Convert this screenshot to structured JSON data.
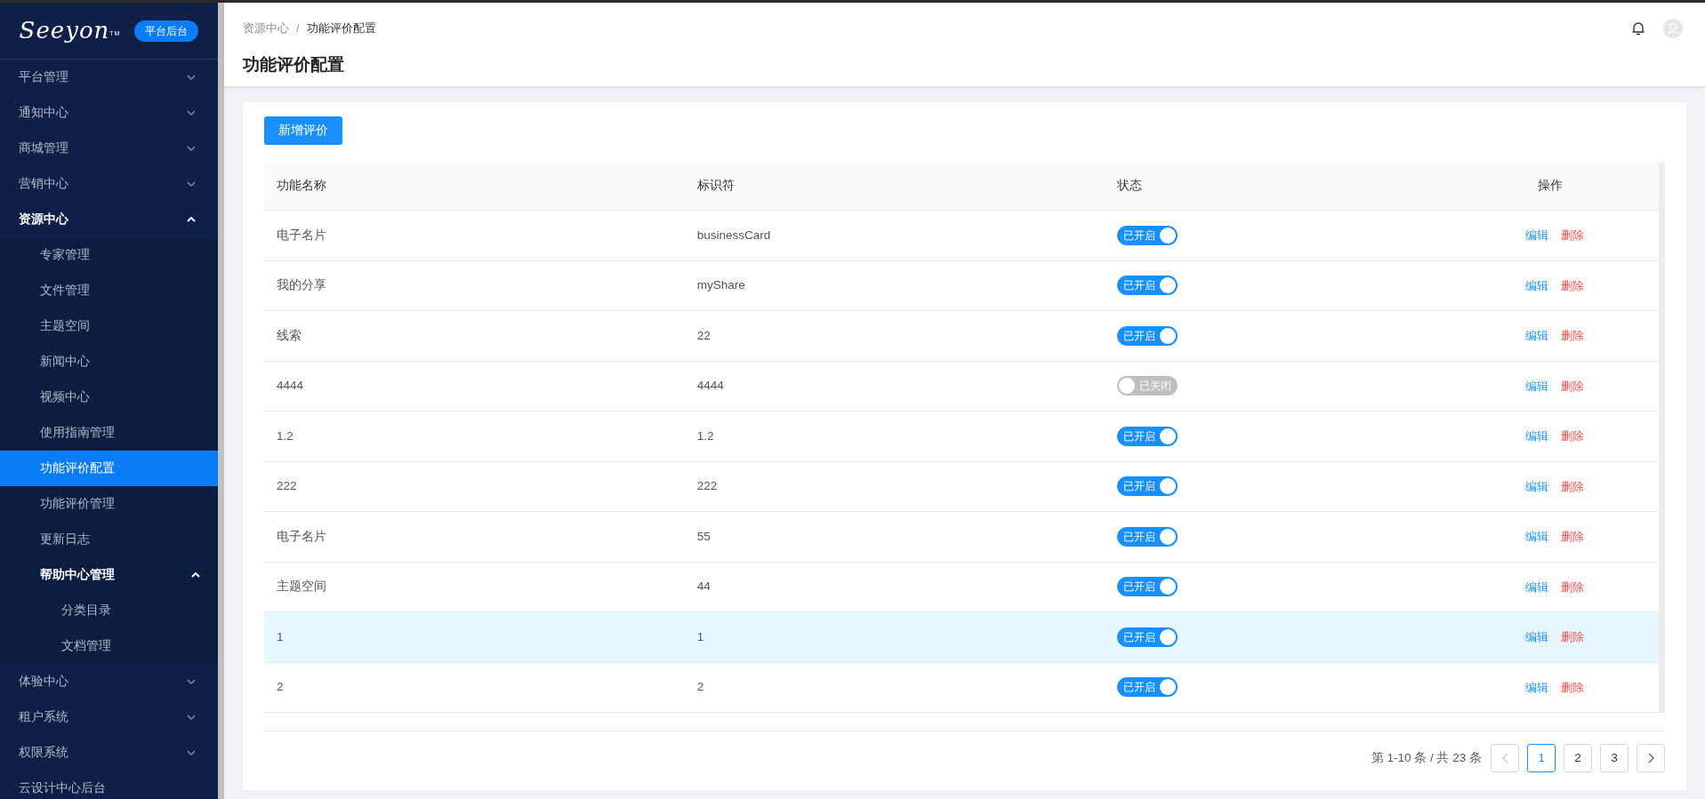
{
  "sidebar": {
    "logo": "Seeyon",
    "logo_mark": "TM",
    "badge": "平台后台",
    "items": [
      {
        "label": "平台管理",
        "expanded": false,
        "selected": false
      },
      {
        "label": "通知中心",
        "expanded": false,
        "selected": false
      },
      {
        "label": "商城管理",
        "expanded": false,
        "selected": false
      },
      {
        "label": "营销中心",
        "expanded": false,
        "selected": false
      },
      {
        "label": "资源中心",
        "expanded": true,
        "selected": false,
        "children": [
          {
            "label": "专家管理",
            "selected": false
          },
          {
            "label": "文件管理",
            "selected": false
          },
          {
            "label": "主题空间",
            "selected": false
          },
          {
            "label": "新闻中心",
            "selected": false
          },
          {
            "label": "视频中心",
            "selected": false
          },
          {
            "label": "使用指南管理",
            "selected": false
          },
          {
            "label": "功能评价配置",
            "selected": true
          },
          {
            "label": "功能评价管理",
            "selected": false
          },
          {
            "label": "更新日志",
            "selected": false
          },
          {
            "label": "帮助中心管理",
            "selected": false,
            "expanded": true,
            "children": [
              {
                "label": "分类目录",
                "selected": false
              },
              {
                "label": "文档管理",
                "selected": false
              }
            ]
          }
        ]
      },
      {
        "label": "体验中心",
        "expanded": false,
        "selected": false
      },
      {
        "label": "租户系统",
        "expanded": false,
        "selected": false
      },
      {
        "label": "权限系统",
        "expanded": false,
        "selected": false
      },
      {
        "label": "云设计中心后台",
        "selected": false
      }
    ]
  },
  "breadcrumb": [
    "资源中心",
    "功能评价配置"
  ],
  "breadcrumb_separator": "/",
  "page_title": "功能评价配置",
  "add_button": "新增评价",
  "table": {
    "columns": [
      "功能名称",
      "标识符",
      "状态",
      "操作"
    ],
    "rows": [
      {
        "name": "电子名片",
        "identifier": "businessCard",
        "on": true,
        "status": "已开启",
        "edit": "编辑",
        "delete": "删除",
        "highlighted": false
      },
      {
        "name": "我的分享",
        "identifier": "myShare",
        "on": true,
        "status": "已开启",
        "edit": "编辑",
        "delete": "删除",
        "highlighted": false
      },
      {
        "name": "线索",
        "identifier": "22",
        "on": true,
        "status": "已开启",
        "edit": "编辑",
        "delete": "删除",
        "highlighted": false
      },
      {
        "name": "4444",
        "identifier": "4444",
        "on": false,
        "status": "已关闭",
        "edit": "编辑",
        "delete": "删除",
        "highlighted": false
      },
      {
        "name": "1.2",
        "identifier": "1.2",
        "on": true,
        "status": "已开启",
        "edit": "编辑",
        "delete": "删除",
        "highlighted": false
      },
      {
        "name": "222",
        "identifier": "222",
        "on": true,
        "status": "已开启",
        "edit": "编辑",
        "delete": "删除",
        "highlighted": false
      },
      {
        "name": "电子名片",
        "identifier": "55",
        "on": true,
        "status": "已开启",
        "edit": "编辑",
        "delete": "删除",
        "highlighted": false
      },
      {
        "name": "主题空间",
        "identifier": "44",
        "on": true,
        "status": "已开启",
        "edit": "编辑",
        "delete": "删除",
        "highlighted": false
      },
      {
        "name": "1",
        "identifier": "1",
        "on": true,
        "status": "已开启",
        "edit": "编辑",
        "delete": "删除",
        "highlighted": true
      },
      {
        "name": "2",
        "identifier": "2",
        "on": true,
        "status": "已开启",
        "edit": "编辑",
        "delete": "删除",
        "highlighted": false
      }
    ]
  },
  "pagination": {
    "summary": "第 1-10 条 / 共 23 条",
    "pages": [
      {
        "label": "1",
        "selected": true
      },
      {
        "label": "2",
        "selected": false
      },
      {
        "label": "3",
        "selected": false
      }
    ]
  }
}
